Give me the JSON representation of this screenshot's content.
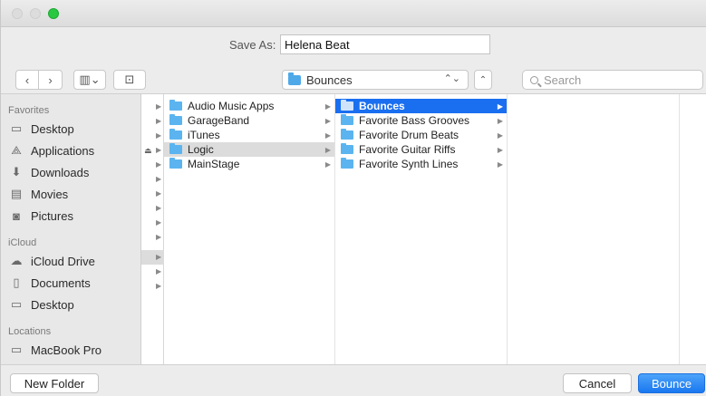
{
  "titlebar": {
    "lights": [
      "close",
      "minimize",
      "zoom"
    ],
    "zoom_color": "#28c940"
  },
  "save": {
    "label": "Save As:",
    "value": "Helena Beat"
  },
  "toolbar": {
    "back": "‹",
    "forward": "›",
    "view": "▥⌄",
    "new_folder_icon": "⊡",
    "location": "Bounces",
    "location_arrows": "⌃⌄",
    "collapse": "⌃",
    "search_placeholder": "Search"
  },
  "sidebar": {
    "favorites_header": "Favorites",
    "favorites": [
      {
        "label": "Desktop",
        "icon": "desktop-icon",
        "glyph": "▭"
      },
      {
        "label": "Applications",
        "icon": "applications-icon",
        "glyph": "⟁"
      },
      {
        "label": "Downloads",
        "icon": "downloads-icon",
        "glyph": "⬇"
      },
      {
        "label": "Movies",
        "icon": "movies-icon",
        "glyph": "▤"
      },
      {
        "label": "Pictures",
        "icon": "pictures-icon",
        "glyph": "◙"
      }
    ],
    "icloud_header": "iCloud",
    "icloud": [
      {
        "label": "iCloud Drive",
        "icon": "cloud-icon",
        "glyph": "☁"
      },
      {
        "label": "Documents",
        "icon": "documents-icon",
        "glyph": "▯"
      },
      {
        "label": "Desktop",
        "icon": "desktop-icon",
        "glyph": "▭"
      }
    ],
    "locations_header": "Locations",
    "locations": [
      {
        "label": "MacBook Pro",
        "icon": "laptop-icon",
        "glyph": "▭"
      }
    ]
  },
  "columns": {
    "col1": [
      {
        "label": "Audio Music Apps",
        "state": "normal"
      },
      {
        "label": "GarageBand",
        "state": "normal"
      },
      {
        "label": "iTunes",
        "state": "normal"
      },
      {
        "label": "Logic",
        "state": "gray"
      },
      {
        "label": "MainStage",
        "state": "normal"
      }
    ],
    "col2": [
      {
        "label": "Bounces",
        "state": "selected"
      },
      {
        "label": "Favorite Bass Grooves",
        "state": "normal"
      },
      {
        "label": "Favorite Drum Beats",
        "state": "normal"
      },
      {
        "label": "Favorite Guitar Riffs",
        "state": "normal"
      },
      {
        "label": "Favorite Synth Lines",
        "state": "normal"
      }
    ]
  },
  "buttons": {
    "new_folder": "New Folder",
    "cancel": "Cancel",
    "bounce": "Bounce"
  },
  "colors": {
    "accent": "#1a6ff0",
    "folder": "#5bb4ef"
  }
}
